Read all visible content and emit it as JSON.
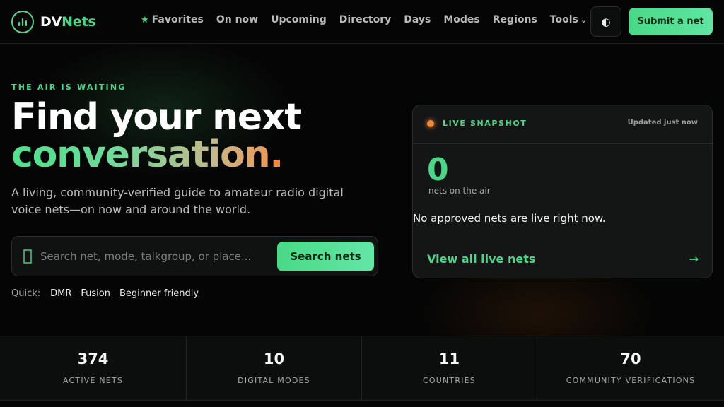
{
  "header": {
    "logo_prefix": "DV",
    "logo_suffix": "Nets",
    "nav": [
      {
        "label": "Favorites",
        "icon": "star-icon"
      },
      {
        "label": "On now"
      },
      {
        "label": "Upcoming"
      },
      {
        "label": "Directory"
      },
      {
        "label": "Days"
      },
      {
        "label": "Modes"
      },
      {
        "label": "Regions"
      },
      {
        "label": "Tools",
        "icon": "chevron-down-icon"
      }
    ],
    "theme_toggle_icon": "◐",
    "submit_label": "Submit a net"
  },
  "hero": {
    "eyebrow": "THE AIR IS WAITING",
    "headline_line1": "Find your next",
    "headline_line2": "conversation",
    "headline_punct": ".",
    "subtitle": "A living, community-verified guide to amateur radio digital voice nets—on now and around the world.",
    "search": {
      "placeholder": "Search net, mode, talkgroup, or place...",
      "value": "",
      "button_label": "Search nets"
    },
    "quick": {
      "label": "Quick:",
      "links": [
        "DMR",
        "Fusion",
        "Beginner friendly"
      ]
    }
  },
  "live_card": {
    "title": "LIVE SNAPSHOT",
    "updated": "Updated just now",
    "count": "0",
    "count_label": "nets on the air",
    "empty_message": "No approved nets are live right now.",
    "view_all_label": "View all live nets",
    "arrow": "→"
  },
  "stats": [
    {
      "value": "374",
      "label": "ACTIVE NETS"
    },
    {
      "value": "10",
      "label": "DIGITAL MODES"
    },
    {
      "value": "11",
      "label": "COUNTRIES"
    },
    {
      "value": "70",
      "label": "COMMUNITY VERIFICATIONS"
    }
  ],
  "colors": {
    "accent": "#4cd68a",
    "live_dot": "#f28a3c",
    "background": "#050505"
  }
}
